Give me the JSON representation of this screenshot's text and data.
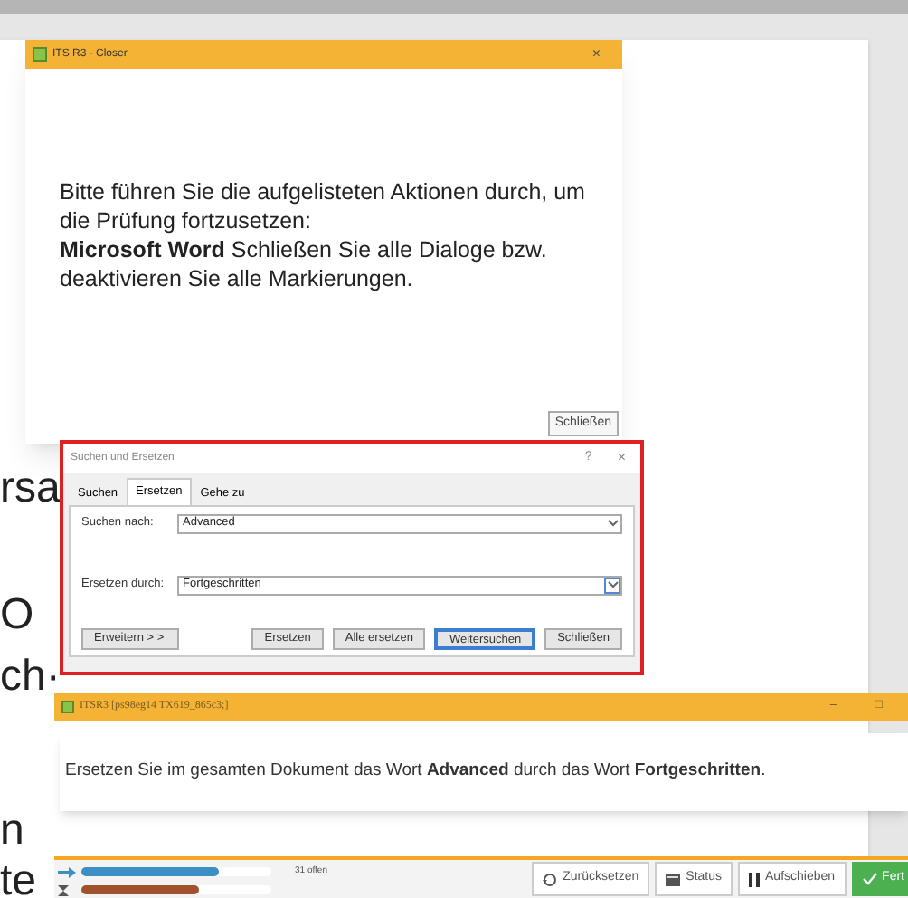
{
  "document": {
    "fragments": [
      "rsa",
      "O",
      "ch·",
      "n",
      "te"
    ]
  },
  "closer_dialog": {
    "title": "ITS R3 - Closer",
    "close": "×",
    "message": "Bitte führen Sie die aufgelisteten Aktionen durch, um die Prüfung fortzusetzen:",
    "detail": "**Microsoft Word** Schließen Sie alle Dialoge bzw. deaktivieren Sie alle Markierungen.",
    "button": "Schließen"
  },
  "find_replace": {
    "title": "Suchen und Ersetzen",
    "help": "?",
    "close": "×",
    "tabs": [
      {
        "label": "Suchen",
        "selected": false
      },
      {
        "label": "Ersetzen",
        "selected": true
      },
      {
        "label": "Gehe zu",
        "selected": false
      }
    ],
    "find_label": "Suchen nach:",
    "find_value": "Advanced",
    "replace_label": "Ersetzen durch:",
    "replace_value": "Fortgeschritten",
    "buttons": [
      {
        "label": "Erweitern > >",
        "default": false
      },
      {
        "label": "Ersetzen",
        "default": false
      },
      {
        "label": "Alle ersetzen",
        "default": false
      },
      {
        "label": "Weitersuchen",
        "default": true
      },
      {
        "label": "Schließen",
        "default": false
      }
    ]
  },
  "task_window": {
    "title": "ITSR3 [ps98eg14 TX619_865c3;]",
    "minimize": "–",
    "maximize": "□",
    "task": "Ersetzen Sie im gesamten Dokument das Wort **Advanced** durch das Wort **Fortgeschritten**."
  },
  "bottom_bar": {
    "progress": [
      {
        "level": 0.72,
        "reading": "31 offen",
        "color": "#3b8fc4"
      },
      {
        "level": 0.62,
        "color": "#a0522d"
      }
    ],
    "buttons": [
      {
        "kind": "reset",
        "label": "Zurücksetzen"
      },
      {
        "kind": "status",
        "label": "Status"
      },
      {
        "kind": "pause",
        "label": "Aufschieben"
      },
      {
        "kind": "finish",
        "label": "Fert"
      }
    ]
  }
}
